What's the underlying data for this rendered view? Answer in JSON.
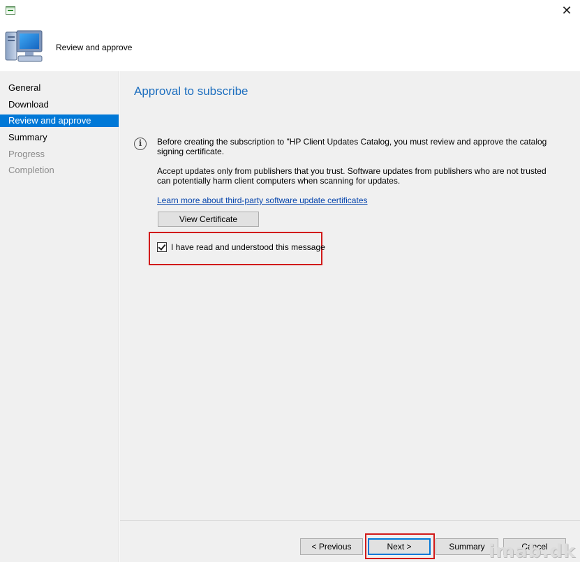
{
  "window": {
    "close_glyph": "✕"
  },
  "header": {
    "title": "Review and approve",
    "icon": "computer-monitor-icon"
  },
  "sidebar": {
    "items": [
      {
        "label": "General",
        "state": "normal"
      },
      {
        "label": "Download",
        "state": "normal"
      },
      {
        "label": "Review and approve",
        "state": "active"
      },
      {
        "label": "Summary",
        "state": "normal"
      },
      {
        "label": "Progress",
        "state": "disabled"
      },
      {
        "label": "Completion",
        "state": "disabled"
      }
    ]
  },
  "main": {
    "title": "Approval to subscribe",
    "info_icon": "info-icon",
    "paragraph1": "Before creating the subscription to \"HP Client Updates Catalog, you must review and approve the catalog signing certificate.",
    "paragraph2": "Accept updates only from publishers that you trust. Software updates from publishers who are not trusted can potentially harm client computers when scanning for updates.",
    "learn_more_link": "Learn more about third-party software update certificates",
    "view_certificate_button": "View Certificate",
    "acknowledge_checkbox": {
      "label": "I have read and understood this message",
      "checked": true
    }
  },
  "footer": {
    "previous": "< Previous",
    "next": "Next >",
    "summary": "Summary",
    "cancel": "Cancel"
  },
  "watermark": "imab.dk",
  "colors": {
    "accent": "#0078d7",
    "title_blue": "#1e6fbf",
    "highlight_red": "#d11a1a",
    "link": "#0645ad",
    "panel_bg": "#f0f0f0"
  }
}
